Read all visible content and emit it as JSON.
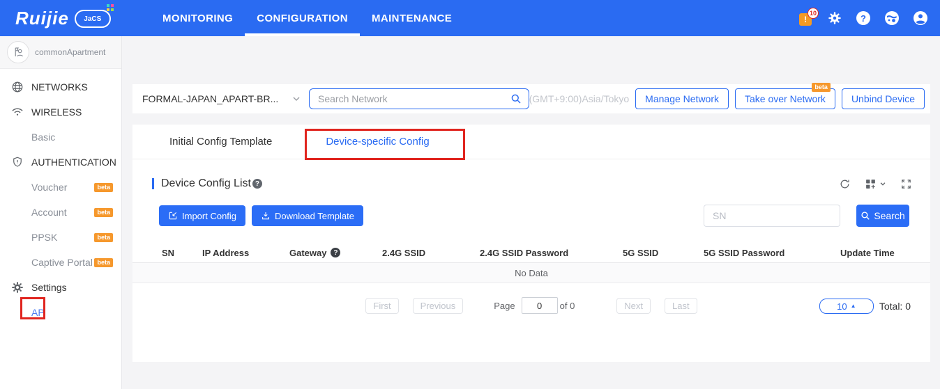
{
  "labels": {
    "beta": "beta"
  },
  "header": {
    "brand": "Ruijie",
    "brand_sub": "JaCS",
    "nav": [
      {
        "label": "MONITORING"
      },
      {
        "label": "CONFIGURATION"
      },
      {
        "label": "MAINTENANCE"
      }
    ],
    "notification_count": "10",
    "icon_names": [
      "notification-icon",
      "settings-gear-icon",
      "help-icon",
      "language-globe-icon",
      "account-icon"
    ]
  },
  "sidebar": {
    "account_name": "commonApartment",
    "items": [
      {
        "label": "NETWORKS",
        "icon": "globe-icon"
      },
      {
        "label": "WIRELESS",
        "icon": "wifi-icon"
      },
      {
        "label": "Basic"
      },
      {
        "label": "AUTHENTICATION",
        "icon": "shield-icon"
      },
      {
        "label": "Voucher",
        "beta": true
      },
      {
        "label": "Account",
        "beta": true
      },
      {
        "label": "PPSK",
        "beta": true
      },
      {
        "label": "Captive Portal",
        "beta": true
      },
      {
        "label": "Settings",
        "icon": "gear-icon"
      },
      {
        "label": "AP",
        "highlighted": true
      }
    ]
  },
  "toolbar": {
    "network_selector_value": "FORMAL-JAPAN_APART-BR...",
    "search_placeholder": "Search Network",
    "timezone": "(GMT+9:00)Asia/Tokyo",
    "manage_network": "Manage Network",
    "take_over_network": "Take over Network",
    "unbind_device": "Unbind Device"
  },
  "tabs": [
    {
      "label": "Initial Config Template"
    },
    {
      "label": "Device-specific Config",
      "active": true
    }
  ],
  "panel": {
    "title": "Device Config List",
    "import_config": "Import Config",
    "download_template": "Download Template",
    "sn_placeholder": "SN",
    "search": "Search",
    "tool_icons": [
      "refresh-icon",
      "column-settings-icon",
      "chevron-down-icon",
      "expand-icon"
    ]
  },
  "table": {
    "columns": [
      "SN",
      "IP Address",
      "Gateway",
      "2.4G SSID",
      "2.4G SSID Password",
      "5G SSID",
      "5G SSID Password",
      "Update Time"
    ],
    "empty_text": "No Data"
  },
  "pagination": {
    "first": "First",
    "previous": "Previous",
    "page_label": "Page",
    "page_value": "0",
    "of_total": "of 0",
    "next": "Next",
    "last": "Last",
    "page_size": "10",
    "total": "Total: 0"
  },
  "colors": {
    "header_bg": "#2a6bf2",
    "accent_blue": "#2a6bf2",
    "primary_button": "#2b6df6",
    "beta_orange": "#f6982c",
    "annotation_red": "#e0251f",
    "page_bg": "#f4f4f6"
  }
}
